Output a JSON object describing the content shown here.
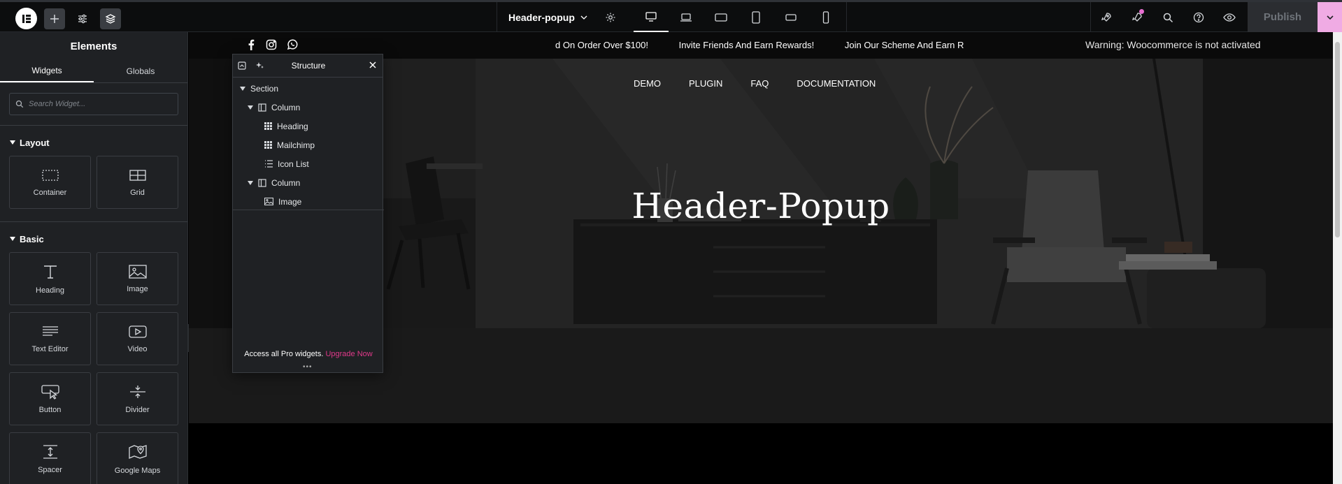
{
  "topbar": {
    "document_title": "Header-popup",
    "publish_label": "Publish",
    "devices": [
      "desktop",
      "laptop",
      "tablet-landscape",
      "tablet",
      "mobile-landscape",
      "mobile"
    ],
    "accent": "#f0abe4"
  },
  "panel": {
    "title": "Elements",
    "tabs": [
      "Widgets",
      "Globals"
    ],
    "search_placeholder": "Search Widget...",
    "categories": [
      {
        "name": "Layout",
        "widgets": [
          "Container",
          "Grid"
        ]
      },
      {
        "name": "Basic",
        "widgets": [
          "Heading",
          "Image",
          "Text Editor",
          "Video",
          "Button",
          "Divider",
          "Spacer",
          "Google Maps"
        ]
      }
    ]
  },
  "structure": {
    "title": "Structure",
    "tree": [
      {
        "label": "Section",
        "level": 0,
        "type": "section"
      },
      {
        "label": "Column",
        "level": 1,
        "type": "column"
      },
      {
        "label": "Heading",
        "level": 2,
        "type": "widget"
      },
      {
        "label": "Mailchimp",
        "level": 2,
        "type": "widget"
      },
      {
        "label": "Icon List",
        "level": 2,
        "type": "list"
      },
      {
        "label": "Column",
        "level": 1,
        "type": "column"
      },
      {
        "label": "Image",
        "level": 2,
        "type": "image"
      }
    ],
    "footer_text": "Access all Pro widgets.",
    "footer_link": "Upgrade Now",
    "link_color": "#e0398a"
  },
  "canvas": {
    "ticker": [
      "d On Order Over $100!",
      "Invite Friends And Earn Rewards!",
      "Join Our Scheme And Earn R"
    ],
    "warning": "Warning: Woocommerce is not activated",
    "nav": [
      "DEMO",
      "PLUGIN",
      "FAQ",
      "DOCUMENTATION"
    ],
    "hero_title": "Header-Popup"
  }
}
